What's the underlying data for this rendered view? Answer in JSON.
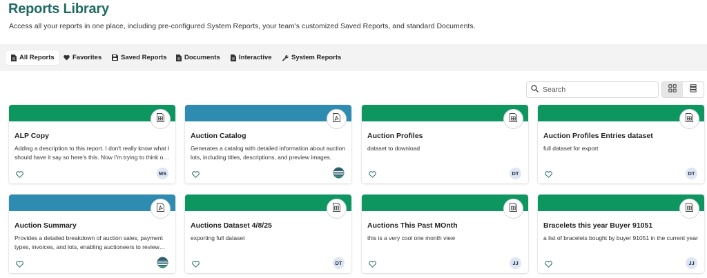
{
  "header": {
    "title": "Reports Library",
    "subtitle": "Access all your reports in one place, including pre-configured System Reports, your team's customized Saved Reports, and standard Documents."
  },
  "tabs": [
    {
      "label": "All Reports",
      "icon": "document-icon",
      "active": true
    },
    {
      "label": "Favorites",
      "icon": "heart-icon",
      "active": false
    },
    {
      "label": "Saved Reports",
      "icon": "save-icon",
      "active": false
    },
    {
      "label": "Documents",
      "icon": "document-icon",
      "active": false
    },
    {
      "label": "Interactive",
      "icon": "document-icon",
      "active": false
    },
    {
      "label": "System Reports",
      "icon": "wrench-icon",
      "active": false
    }
  ],
  "search": {
    "placeholder": "Search",
    "value": ""
  },
  "view_toggle": {
    "grid_active": true
  },
  "colors": {
    "green": "#0e9660",
    "blue": "#2e8cb0",
    "title": "#1f6b63"
  },
  "cards": [
    {
      "title": "ALP Copy",
      "description": "Adding a description to this report. I don't really know what I should have it say so here's this. Now I'm trying to think of more words to add here.",
      "type": "table",
      "band": "green",
      "owner": "MS"
    },
    {
      "title": "Auction Catalog",
      "description": "Generates a catalog with detailed information about auction lots, including titles, descriptions, and preview images.",
      "type": "pdf",
      "band": "blue",
      "owner": "logo"
    },
    {
      "title": "Auction Profiles",
      "description": "dataset to download",
      "type": "table",
      "band": "green",
      "owner": "DT"
    },
    {
      "title": "Auction Profiles Entries dataset",
      "description": "full dataset for export",
      "type": "table",
      "band": "green",
      "owner": "DT"
    },
    {
      "title": "Auction Summary",
      "description": "Provides a detailed breakdown of auction sales, payment types, invoices, and lots, enabling auctioneers to review results.",
      "type": "pdf",
      "band": "blue",
      "owner": "logo"
    },
    {
      "title": "Auctions Dataset 4/8/25",
      "description": "exporting full dataset",
      "type": "table",
      "band": "green",
      "owner": "DT"
    },
    {
      "title": "Auctions This Past MOnth",
      "description": "this is a very cool one month view",
      "type": "table",
      "band": "green",
      "owner": "JJ"
    },
    {
      "title": "Bracelets this year Buyer 91051",
      "description": "a list of bracelets bought by buyer 91051 in the current year",
      "type": "table",
      "band": "green",
      "owner": "JJ"
    }
  ]
}
